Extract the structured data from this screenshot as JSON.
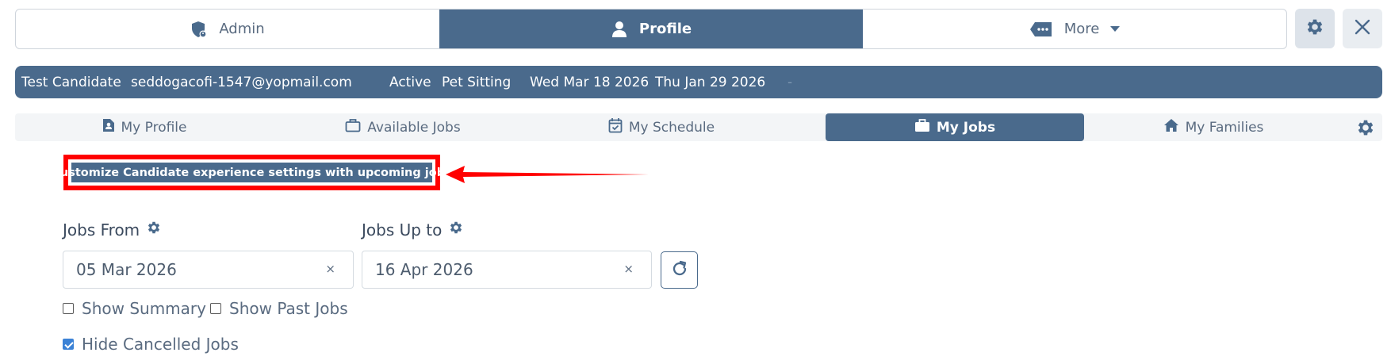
{
  "top_nav": {
    "admin_label": "Admin",
    "profile_label": "Profile",
    "more_label": "More",
    "active": "Profile"
  },
  "candidate": {
    "name": "Test Candidate",
    "email": "seddogacofi-1547@yopmail.com",
    "status": "Active",
    "service": "Pet Sitting",
    "date_1": "Wed Mar 18 2026",
    "date_2": "Thu Jan 29 2026",
    "separator": "-"
  },
  "tabs": [
    {
      "label": "My Profile",
      "icon": "id-card-icon"
    },
    {
      "label": "Available Jobs",
      "icon": "briefcase-outline-icon"
    },
    {
      "label": "My Schedule",
      "icon": "calendar-check-icon"
    },
    {
      "label": "My Jobs",
      "icon": "briefcase-icon",
      "active": true
    },
    {
      "label": "My Families",
      "icon": "home-icon"
    }
  ],
  "banner": {
    "label": "Customize Candidate experience settings with upcoming jobs"
  },
  "filters": {
    "jobs_from_label": "Jobs From",
    "jobs_from_value": "05 Mar 2026",
    "jobs_up_to_label": "Jobs Up to",
    "jobs_up_to_value": "16 Apr 2026",
    "clear_glyph": "×",
    "show_summary": {
      "label": "Show Summary",
      "checked": false
    },
    "show_past_jobs": {
      "label": "Show Past Jobs",
      "checked": false
    },
    "hide_cancelled_jobs": {
      "label": "Hide Cancelled Jobs",
      "checked": true
    }
  },
  "colors": {
    "primary": "#4a6a8c",
    "highlight": "#ff0000",
    "checkbox_accent": "#3b82d6"
  }
}
